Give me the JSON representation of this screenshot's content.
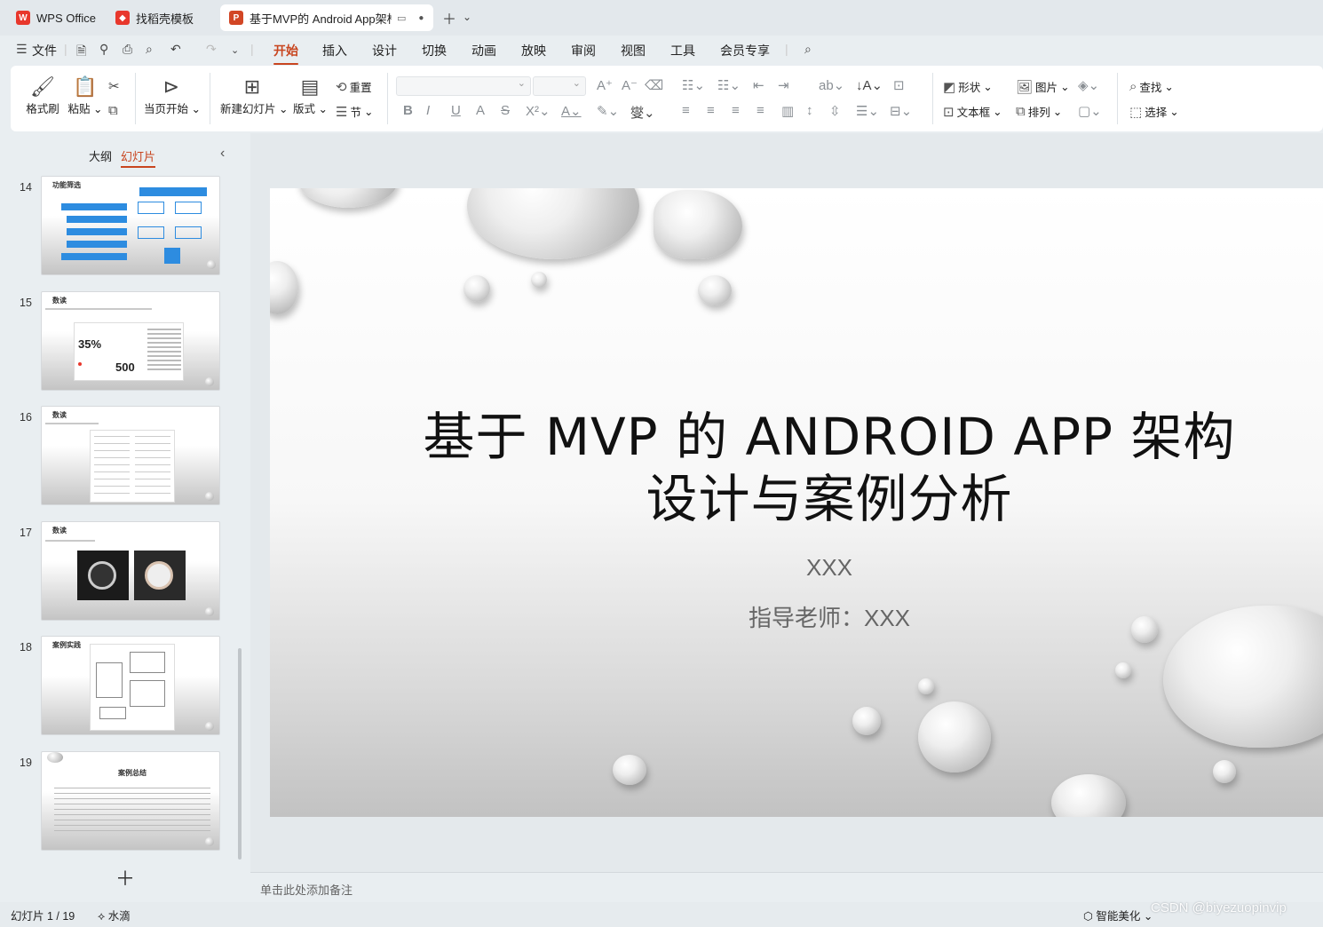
{
  "tabs": [
    {
      "label": "WPS Office",
      "icon": "wps-logo-icon"
    },
    {
      "label": "找稻壳模板",
      "icon": "daoke-logo-icon"
    },
    {
      "label": "基于MVP的 Android App架构",
      "icon": "presentation-file-icon"
    }
  ],
  "menu": {
    "file": "文件",
    "items": [
      "开始",
      "插入",
      "设计",
      "切换",
      "动画",
      "放映",
      "审阅",
      "视图",
      "工具",
      "会员专享"
    ],
    "active": "开始"
  },
  "ribbon": {
    "format_painter": "格式刷",
    "paste": "粘贴",
    "from_current": "当页开始",
    "new_slide": "新建幻灯片",
    "layout": "版式",
    "reset": "重置",
    "section": "节",
    "shape": "形状",
    "picture": "图片",
    "textbox": "文本框",
    "arrange": "排列",
    "find": "查找",
    "select": "选择"
  },
  "panel": {
    "outline": "大纲",
    "slides": "幻灯片",
    "thumbnails": [
      {
        "num": "14",
        "title": "功能筛选"
      },
      {
        "num": "15",
        "title": "数读"
      },
      {
        "num": "16",
        "title": "数读"
      },
      {
        "num": "17",
        "title": "数读"
      },
      {
        "num": "18",
        "title": "案例实践"
      },
      {
        "num": "19",
        "title": "案例总结"
      }
    ],
    "thumb15": {
      "big1": "35%",
      "big2": "500"
    }
  },
  "slide": {
    "title_line1": "基于 MVP 的 ANDROID APP 架构",
    "title_line2": "设计与案例分析",
    "author": "XXX",
    "advisor": "指导老师：XXX"
  },
  "notes_placeholder": "单击此处添加备注",
  "status": {
    "slide_counter": "幻灯片 1 / 19",
    "theme": "水滴",
    "smart_beautify": "智能美化",
    "watermark": "CSDN @biyezuopinvip"
  },
  "colors": {
    "accent": "#c8451f",
    "wps_red": "#e8372c"
  }
}
